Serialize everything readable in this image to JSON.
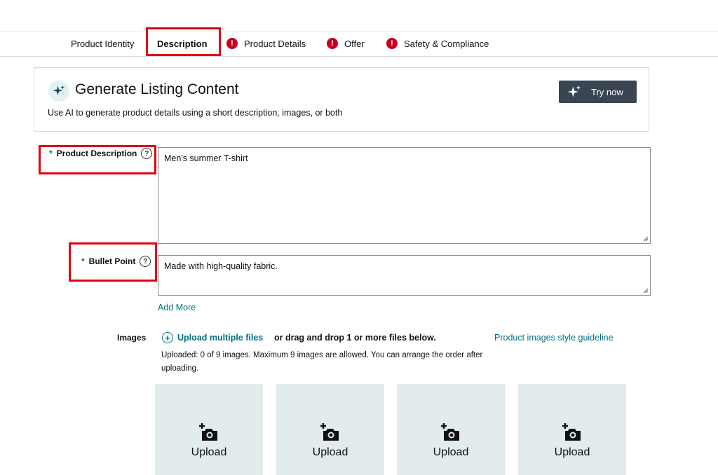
{
  "tabs": [
    {
      "label": "Product Identity",
      "error": false,
      "active": false
    },
    {
      "label": "Description",
      "error": false,
      "active": true
    },
    {
      "label": "Product Details",
      "error": true,
      "active": false
    },
    {
      "label": "Offer",
      "error": true,
      "active": false
    },
    {
      "label": "Safety & Compliance",
      "error": true,
      "active": false
    }
  ],
  "error_glyph": "!",
  "generate": {
    "title": "Generate Listing Content",
    "subtitle": "Use AI to generate product details using a short description, images, or both",
    "button_label": "Try now",
    "icon": "sparkle-icon"
  },
  "fields": {
    "required_mark": "*",
    "help_glyph": "?",
    "product_description": {
      "label": "Product Description",
      "value": "Men's summer T-shirt"
    },
    "bullet_point": {
      "label": "Bullet Point",
      "value": "Made with high-quality fabric."
    }
  },
  "add_more_label": "Add More",
  "images": {
    "label": "Images",
    "upload_multiple_label": "Upload multiple files",
    "drag_text": "or drag and drop 1 or more files below.",
    "guideline_link": "Product images style guideline",
    "uploaded_text": "Uploaded: 0 of 9 images. Maximum 9 images are allowed. You can arrange the order after uploading.",
    "slots": [
      {
        "label": "Upload"
      },
      {
        "label": "Upload"
      },
      {
        "label": "Upload"
      },
      {
        "label": "Upload"
      }
    ]
  },
  "colors": {
    "accent": "#007185",
    "error": "#c40021",
    "highlight": "#e3000f",
    "button_bg": "#3a4553",
    "upload_tile": "#e3eced"
  }
}
